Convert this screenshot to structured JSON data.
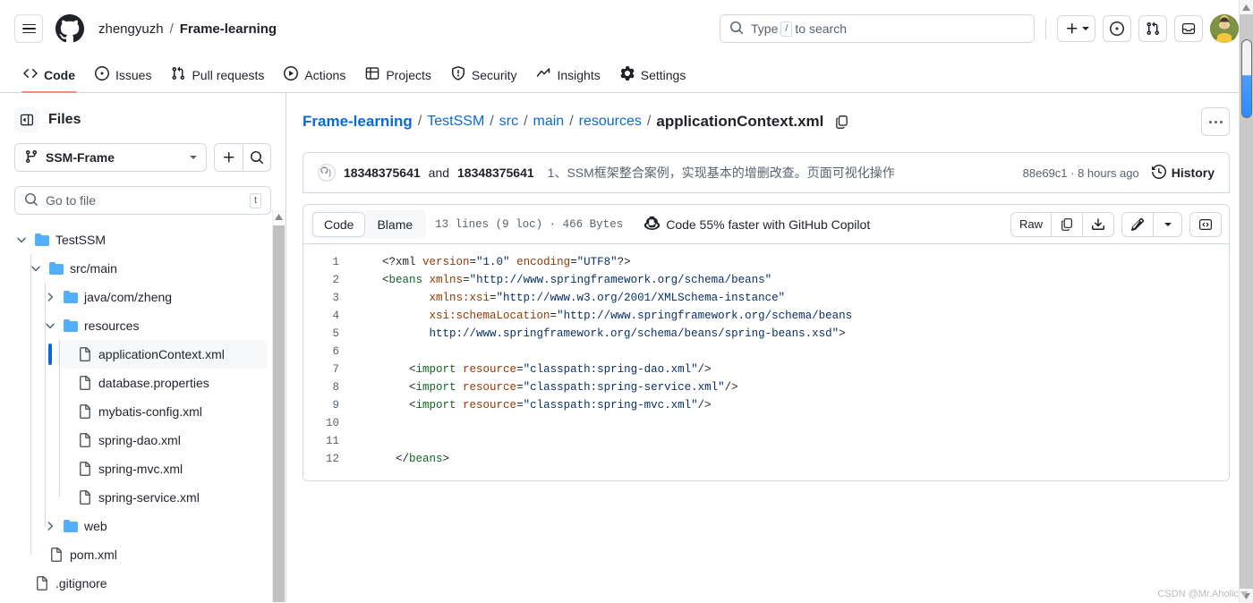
{
  "header": {
    "owner": "zhengyuzh",
    "separator": "/",
    "repo": "Frame-learning",
    "search_placeholder": "Type",
    "search_kbd": "/",
    "search_placeholder_tail": "to search",
    "icons": {
      "menu": "hamburger-icon",
      "logo": "github-logo-icon",
      "search": "search-icon",
      "plus": "plus-icon",
      "issues": "issue-opened-icon",
      "pulls": "git-pull-request-icon",
      "inbox": "inbox-icon",
      "avatar": "user-avatar"
    }
  },
  "nav": {
    "items": [
      {
        "label": "Code",
        "icon": "code-icon",
        "active": true
      },
      {
        "label": "Issues",
        "icon": "issue-opened-icon",
        "active": false
      },
      {
        "label": "Pull requests",
        "icon": "git-pull-request-icon",
        "active": false
      },
      {
        "label": "Actions",
        "icon": "play-icon",
        "active": false
      },
      {
        "label": "Projects",
        "icon": "table-icon",
        "active": false
      },
      {
        "label": "Security",
        "icon": "shield-icon",
        "active": false
      },
      {
        "label": "Insights",
        "icon": "graph-icon",
        "active": false
      },
      {
        "label": "Settings",
        "icon": "gear-icon",
        "active": false
      }
    ],
    "active_underline_color": "#fd8c73"
  },
  "sidebar": {
    "title": "Files",
    "branch": "SSM-Frame",
    "go_to_file_placeholder": "Go to file",
    "go_to_file_kbd": "t",
    "tree": [
      {
        "label": "TestSSM",
        "type": "folder",
        "depth": 0,
        "expanded": true,
        "selected": false
      },
      {
        "label": "src/main",
        "type": "folder",
        "depth": 1,
        "expanded": true,
        "selected": false
      },
      {
        "label": "java/com/zheng",
        "type": "folder",
        "depth": 2,
        "expanded": false,
        "selected": false
      },
      {
        "label": "resources",
        "type": "folder",
        "depth": 2,
        "expanded": true,
        "selected": false
      },
      {
        "label": "applicationContext.xml",
        "type": "file",
        "depth": 3,
        "selected": true
      },
      {
        "label": "database.properties",
        "type": "file",
        "depth": 3,
        "selected": false
      },
      {
        "label": "mybatis-config.xml",
        "type": "file",
        "depth": 3,
        "selected": false
      },
      {
        "label": "spring-dao.xml",
        "type": "file",
        "depth": 3,
        "selected": false
      },
      {
        "label": "spring-mvc.xml",
        "type": "file",
        "depth": 3,
        "selected": false
      },
      {
        "label": "spring-service.xml",
        "type": "file",
        "depth": 3,
        "selected": false
      },
      {
        "label": "web",
        "type": "folder",
        "depth": 2,
        "expanded": false,
        "selected": false
      },
      {
        "label": "pom.xml",
        "type": "file",
        "depth": 1,
        "selected": false
      },
      {
        "label": ".gitignore",
        "type": "file",
        "depth": 0,
        "selected": false
      }
    ]
  },
  "breadcrumb": {
    "parts": [
      {
        "text": "Frame-learning",
        "link": true
      },
      {
        "text": "TestSSM",
        "link": true
      },
      {
        "text": "src",
        "link": true
      },
      {
        "text": "main",
        "link": true
      },
      {
        "text": "resources",
        "link": true
      }
    ],
    "current": "applicationContext.xml",
    "separator": "/",
    "copy_icon": "copy-path-icon",
    "kebab_label": "more-options"
  },
  "commit": {
    "author_1": "18348375641",
    "and": "and",
    "author_2": "18348375641",
    "message": "1、SSM框架整合案例，实现基本的增删改查。页面可视化操作",
    "sha": "88e69c1",
    "sha_sep": "·",
    "time": "8 hours ago",
    "history_label": "History"
  },
  "file_toolbar": {
    "tabs": [
      {
        "label": "Code",
        "active": true
      },
      {
        "label": "Blame",
        "active": false
      }
    ],
    "lines_meta": "13 lines (9 loc) · 466 Bytes",
    "copilot_cta": "Code 55% faster with GitHub Copilot",
    "raw_label": "Raw",
    "buttons": [
      "copy-icon",
      "download-icon",
      "edit-pencil-icon",
      "chevron-down-icon",
      "code-symbols-icon"
    ]
  },
  "code": {
    "language": "xml",
    "lines": [
      {
        "n": 1,
        "tokens": [
          {
            "t": "punct",
            "v": "<?xml "
          },
          {
            "t": "attr",
            "v": "version"
          },
          {
            "t": "punct",
            "v": "="
          },
          {
            "t": "str",
            "v": "\"1.0\""
          },
          {
            "t": "punct",
            "v": " "
          },
          {
            "t": "attr",
            "v": "encoding"
          },
          {
            "t": "punct",
            "v": "="
          },
          {
            "t": "str",
            "v": "\"UTF8\""
          },
          {
            "t": "punct",
            "v": "?>"
          }
        ]
      },
      {
        "n": 2,
        "tokens": [
          {
            "t": "punct",
            "v": "<"
          },
          {
            "t": "tag",
            "v": "beans"
          },
          {
            "t": "punct",
            "v": " "
          },
          {
            "t": "attr",
            "v": "xmlns"
          },
          {
            "t": "punct",
            "v": "="
          },
          {
            "t": "str",
            "v": "\"http://www.springframework.org/schema/beans\""
          }
        ]
      },
      {
        "n": 3,
        "tokens": [
          {
            "t": "punct",
            "v": "       "
          },
          {
            "t": "attr",
            "v": "xmlns:xsi"
          },
          {
            "t": "punct",
            "v": "="
          },
          {
            "t": "str",
            "v": "\"http://www.w3.org/2001/XMLSchema-instance\""
          }
        ]
      },
      {
        "n": 4,
        "tokens": [
          {
            "t": "punct",
            "v": "       "
          },
          {
            "t": "attr",
            "v": "xsi:schemaLocation"
          },
          {
            "t": "punct",
            "v": "="
          },
          {
            "t": "str",
            "v": "\"http://www.springframework.org/schema/beans"
          }
        ]
      },
      {
        "n": 5,
        "tokens": [
          {
            "t": "punct",
            "v": "       "
          },
          {
            "t": "str",
            "v": "http://www.springframework.org/schema/beans/spring-beans.xsd\""
          },
          {
            "t": "punct",
            "v": ">"
          }
        ]
      },
      {
        "n": 6,
        "tokens": []
      },
      {
        "n": 7,
        "tokens": [
          {
            "t": "punct",
            "v": "    <"
          },
          {
            "t": "tag",
            "v": "import"
          },
          {
            "t": "punct",
            "v": " "
          },
          {
            "t": "attr",
            "v": "resource"
          },
          {
            "t": "punct",
            "v": "="
          },
          {
            "t": "str",
            "v": "\"classpath:spring-dao.xml\""
          },
          {
            "t": "punct",
            "v": "/>"
          }
        ]
      },
      {
        "n": 8,
        "tokens": [
          {
            "t": "punct",
            "v": "    <"
          },
          {
            "t": "tag",
            "v": "import"
          },
          {
            "t": "punct",
            "v": " "
          },
          {
            "t": "attr",
            "v": "resource"
          },
          {
            "t": "punct",
            "v": "="
          },
          {
            "t": "str",
            "v": "\"classpath:spring-service.xml\""
          },
          {
            "t": "punct",
            "v": "/>"
          }
        ]
      },
      {
        "n": 9,
        "tokens": [
          {
            "t": "punct",
            "v": "    <"
          },
          {
            "t": "tag",
            "v": "import"
          },
          {
            "t": "punct",
            "v": " "
          },
          {
            "t": "attr",
            "v": "resource"
          },
          {
            "t": "punct",
            "v": "="
          },
          {
            "t": "str",
            "v": "\"classpath:spring-mvc.xml\""
          },
          {
            "t": "punct",
            "v": "/>"
          }
        ]
      },
      {
        "n": 10,
        "tokens": []
      },
      {
        "n": 11,
        "tokens": []
      },
      {
        "n": 12,
        "tokens": [
          {
            "t": "punct",
            "v": "  </"
          },
          {
            "t": "tag",
            "v": "beans"
          },
          {
            "t": "punct",
            "v": ">"
          }
        ]
      }
    ]
  },
  "watermark": "CSDN @Mr.Aholic",
  "colors": {
    "accent": "#0969da",
    "active_tab_underline": "#fd8c73",
    "folder": "#54aeff",
    "border": "#d1d9e0",
    "muted_text": "#59636e",
    "code_tag": "#116329",
    "code_attr": "#953800",
    "code_string": "#0a3069"
  }
}
